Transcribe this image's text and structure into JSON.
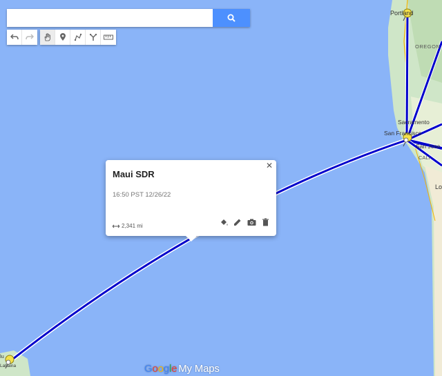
{
  "search": {
    "placeholder": "",
    "value": ""
  },
  "toolbar": {
    "undo_icon": "undo-icon",
    "redo_icon": "redo-icon",
    "hand_icon": "hand-icon",
    "marker_icon": "marker-icon",
    "draw_line_icon": "draw-line-icon",
    "directions_icon": "directions-icon",
    "ruler_icon": "ruler-icon"
  },
  "popup": {
    "title": "Maui SDR",
    "time": "16:50 PST 12/26/22",
    "distance": "2,341 mi",
    "actions": [
      "paint-bucket-icon",
      "edit-icon",
      "camera-icon",
      "delete-icon"
    ]
  },
  "map_labels": {
    "portland": "Portland",
    "oregon": "OREGON",
    "sacramento": "Sacramento",
    "san_francisco": "San Francisco",
    "san_jose": "San Jose",
    "cali": "CALI",
    "lo": "Lo",
    "lu": "lu",
    "lahaina": "Lahaina"
  },
  "branding": {
    "google": "Google",
    "product": "My Maps"
  },
  "colors": {
    "ocean": "#8ab4f8",
    "route": "#0000cc",
    "land": "#cfe6c8",
    "pin": "#f5e14a",
    "accent": "#4d90fe"
  }
}
